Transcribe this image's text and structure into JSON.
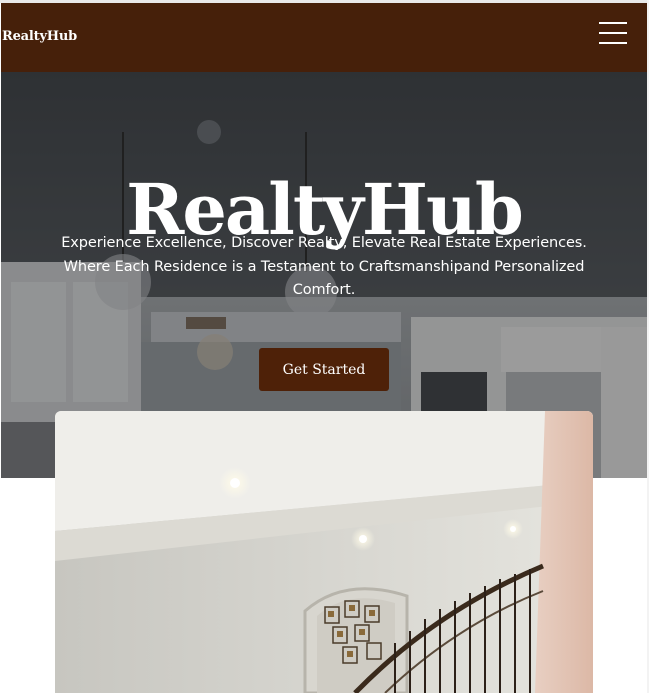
{
  "navbar": {
    "brand": "RealtyHub",
    "menu_icon": "hamburger-menu-icon"
  },
  "hero": {
    "title": "RealtyHub",
    "line1": "Experience Excellence, Discover Realty, Elevate Real Estate Experiences.",
    "line2": "Where Each Residence is a Testament to Craftsmanshipand Personalized Comfort.",
    "cta_label": "Get Started"
  },
  "colors": {
    "navbar_bg": "#46200a",
    "cta_bg": "#4e2108",
    "text": "#ffffff"
  }
}
